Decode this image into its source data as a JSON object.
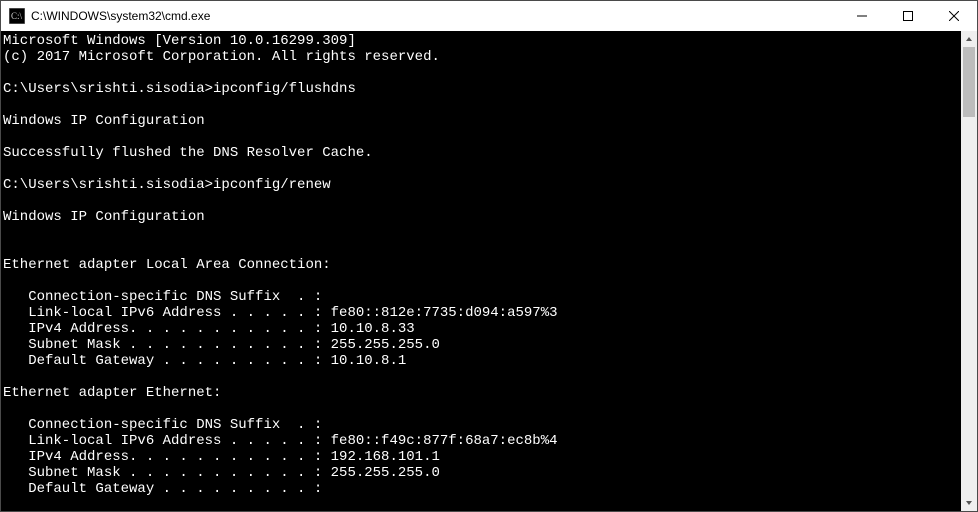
{
  "titlebar": {
    "title": "C:\\WINDOWS\\system32\\cmd.exe"
  },
  "console": {
    "lines": [
      "Microsoft Windows [Version 10.0.16299.309]",
      "(c) 2017 Microsoft Corporation. All rights reserved.",
      "",
      "C:\\Users\\srishti.sisodia>ipconfig/flushdns",
      "",
      "Windows IP Configuration",
      "",
      "Successfully flushed the DNS Resolver Cache.",
      "",
      "C:\\Users\\srishti.sisodia>ipconfig/renew",
      "",
      "Windows IP Configuration",
      "",
      "",
      "Ethernet adapter Local Area Connection:",
      "",
      "   Connection-specific DNS Suffix  . :",
      "   Link-local IPv6 Address . . . . . : fe80::812e:7735:d094:a597%3",
      "   IPv4 Address. . . . . . . . . . . : 10.10.8.33",
      "   Subnet Mask . . . . . . . . . . . : 255.255.255.0",
      "   Default Gateway . . . . . . . . . : 10.10.8.1",
      "",
      "Ethernet adapter Ethernet:",
      "",
      "   Connection-specific DNS Suffix  . :",
      "   Link-local IPv6 Address . . . . . : fe80::f49c:877f:68a7:ec8b%4",
      "   IPv4 Address. . . . . . . . . . . : 192.168.101.1",
      "   Subnet Mask . . . . . . . . . . . : 255.255.255.0",
      "   Default Gateway . . . . . . . . . :"
    ]
  }
}
